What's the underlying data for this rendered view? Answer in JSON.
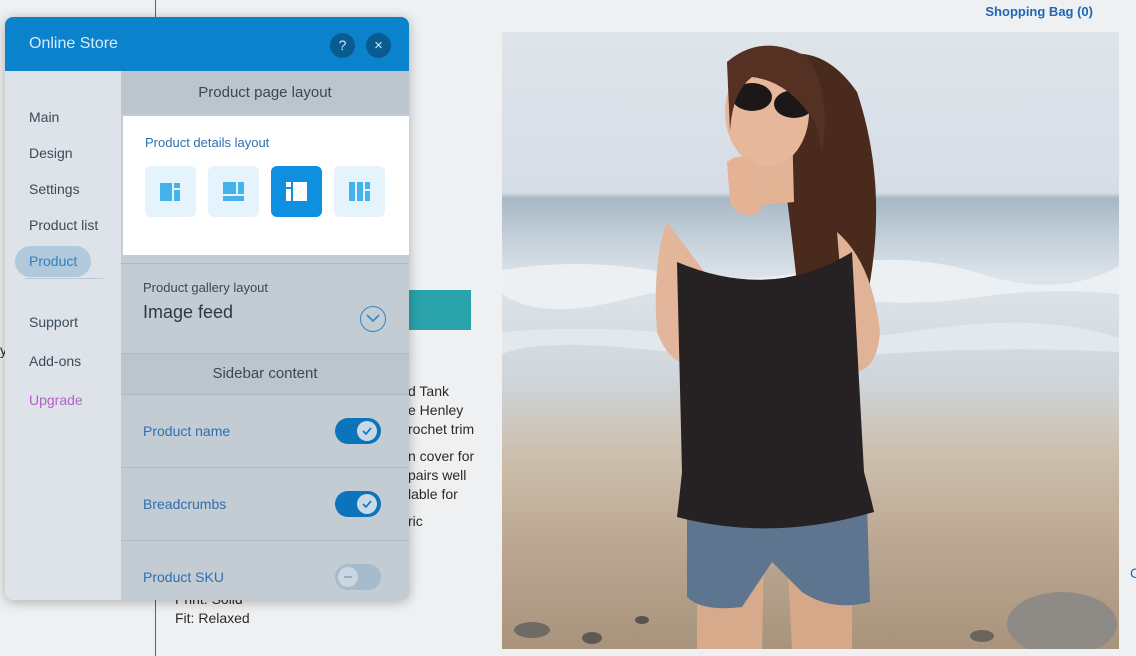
{
  "site": {
    "shopping_bag": "Shopping Bag (0)",
    "description_lines": [
      "d Tank",
      "e Henley",
      "rochet trim",
      "",
      "n cover for",
      "pairs well",
      "lable for",
      "",
      "ric"
    ],
    "print_line": "Print: Solid",
    "fit_line": "Fit: Relaxed",
    "stray_left": "y",
    "stray_right": "C"
  },
  "panel": {
    "title": "Online Store",
    "help_icon": "?",
    "close_icon": "×",
    "nav": {
      "main": "Main",
      "design": "Design",
      "settings": "Settings",
      "product_list": "Product list",
      "product": "Product",
      "support": "Support",
      "addons": "Add-ons",
      "upgrade": "Upgrade"
    },
    "product_page_layout_heading": "Product page layout",
    "details_layout_label": "Product details layout",
    "details_layout_icons": [
      "layout-left-image-icon",
      "layout-top-image-icon",
      "layout-sidebar-left-icon",
      "layout-columns-icon"
    ],
    "details_layout_selected": 2,
    "gallery_label": "Product gallery layout",
    "gallery_value": "Image feed",
    "sidebar_heading": "Sidebar content",
    "toggles": [
      {
        "label": "Product name",
        "on": true
      },
      {
        "label": "Breadcrumbs",
        "on": true
      },
      {
        "label": "Product SKU",
        "on": false
      }
    ]
  },
  "colors": {
    "header_blue": "#0b82cc",
    "accent_blue": "#0e8fe0",
    "upgrade_purple": "#b65ec9",
    "teal_button": "#2ba3ab"
  }
}
